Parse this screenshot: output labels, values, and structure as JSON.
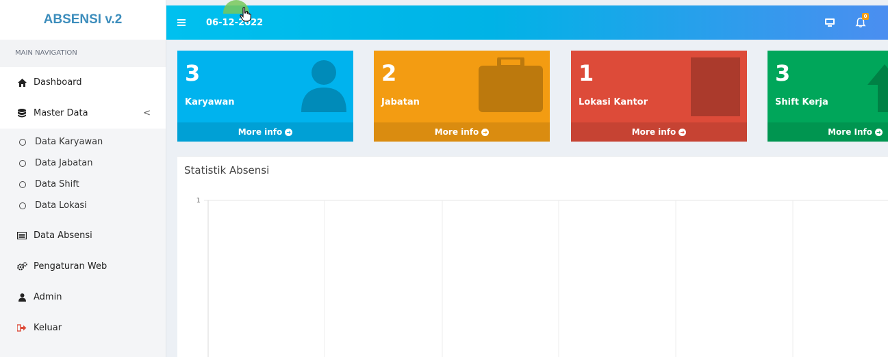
{
  "brand": {
    "title": "ABSENSI v.2"
  },
  "sidebar": {
    "header": "MAIN NAVIGATION",
    "dashboard": "Dashboard",
    "master_data": "Master Data",
    "master_caret": "<",
    "sub_items": [
      "Data Karyawan",
      "Data Jabatan",
      "Data Shift",
      "Data Lokasi"
    ],
    "data_absensi": "Data Absensi",
    "pengaturan_web": "Pengaturan Web",
    "admin": "Admin",
    "keluar": "Keluar"
  },
  "topbar": {
    "date": "06-12-2022",
    "notification_count": "0"
  },
  "boxes": [
    {
      "number": "3",
      "label": "Karyawan",
      "footer": "More info",
      "color": "#00b3ee",
      "icon": "user-icon"
    },
    {
      "number": "2",
      "label": "Jabatan",
      "footer": "More info",
      "color": "#f39c12",
      "icon": "briefcase-icon"
    },
    {
      "number": "1",
      "label": "Lokasi Kantor",
      "footer": "More info",
      "color": "#dd4b39",
      "icon": "building-icon"
    },
    {
      "number": "3",
      "label": "Shift Kerja",
      "footer": "More Info",
      "color": "#00a65a",
      "icon": "arrow-up-icon"
    }
  ],
  "panel": {
    "title": "Statistik Absensi"
  },
  "chart_data": {
    "type": "line",
    "title": "",
    "y_ticks": [
      "1"
    ],
    "ylim": [
      0,
      1
    ],
    "grid": true,
    "series": []
  },
  "colors": {
    "accent": "#3c8dbc",
    "topbar_start": "#00c0ef",
    "topbar_end": "#4b8ef0"
  }
}
